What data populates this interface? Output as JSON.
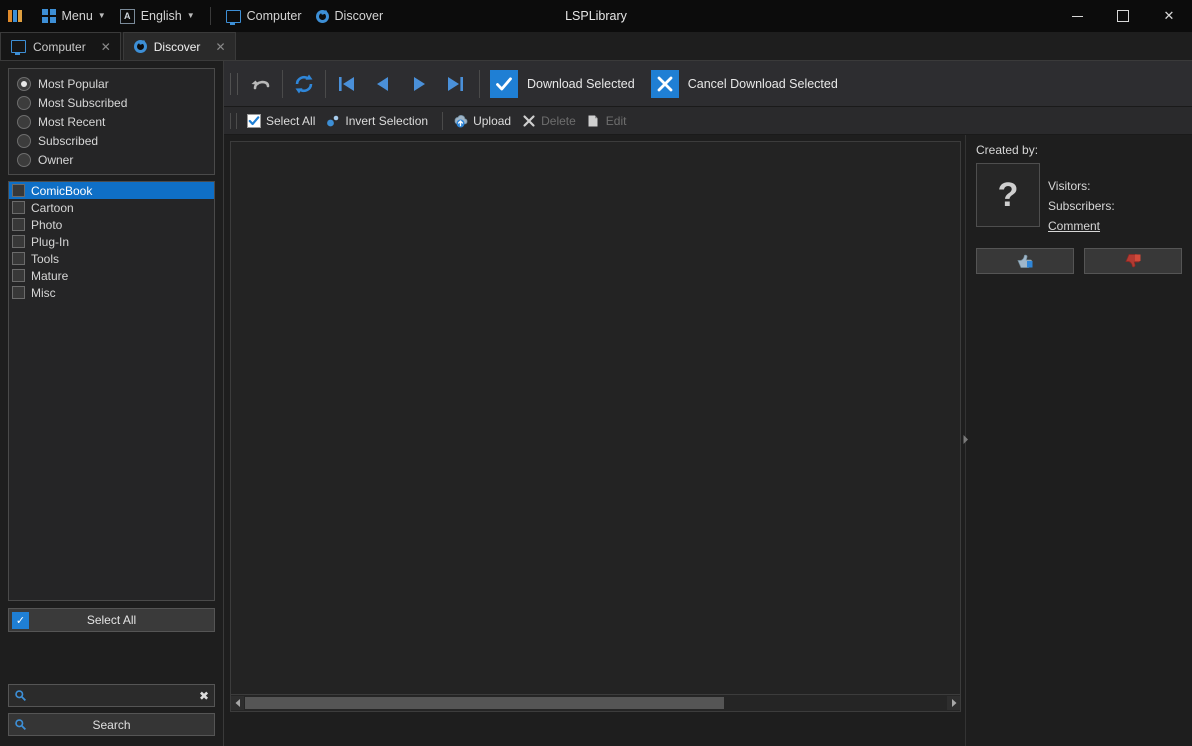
{
  "window": {
    "title": "LSPLibrary",
    "minimize_label": "─",
    "maximize_label": "□",
    "close_label": "✕"
  },
  "menubar": {
    "logo": "lsp-logo-icon",
    "items": [
      {
        "label": "Menu",
        "icon": "windows-grid-icon",
        "has_caret": true
      },
      {
        "label": "English",
        "icon": "language-a-icon",
        "has_caret": true
      }
    ],
    "links": [
      {
        "label": "Computer",
        "icon": "monitor-icon"
      },
      {
        "label": "Discover",
        "icon": "discover-globe-icon"
      }
    ]
  },
  "tabs": [
    {
      "label": "Computer",
      "icon": "monitor-icon",
      "close": "✕",
      "active": false
    },
    {
      "label": "Discover",
      "icon": "discover-globe-icon",
      "close": "✕",
      "active": true
    }
  ],
  "sidebar": {
    "sort_options": [
      {
        "label": "Most Popular",
        "selected": true
      },
      {
        "label": "Most Subscribed",
        "selected": false
      },
      {
        "label": "Most Recent",
        "selected": false
      },
      {
        "label": "Subscribed",
        "selected": false
      },
      {
        "label": "Owner",
        "selected": false
      }
    ],
    "categories": [
      {
        "label": "ComicBook",
        "checked": false,
        "selected": true
      },
      {
        "label": "Cartoon",
        "checked": false,
        "selected": false
      },
      {
        "label": "Photo",
        "checked": false,
        "selected": false
      },
      {
        "label": "Plug-In",
        "checked": false,
        "selected": false
      },
      {
        "label": "Tools",
        "checked": false,
        "selected": false
      },
      {
        "label": "Mature",
        "checked": false,
        "selected": false
      },
      {
        "label": "Misc",
        "checked": false,
        "selected": false
      }
    ],
    "select_all_label": "Select All",
    "search": {
      "value": "",
      "placeholder": "",
      "clear_label": "✖",
      "button_label": "Search"
    }
  },
  "toolbar_primary": {
    "buttons": [
      {
        "name": "undo",
        "icon": "undo-arrow-icon"
      },
      {
        "name": "refresh",
        "icon": "refresh-icon"
      },
      {
        "name": "first",
        "icon": "skip-first-icon"
      },
      {
        "name": "previous",
        "icon": "previous-icon"
      },
      {
        "name": "next",
        "icon": "next-icon"
      },
      {
        "name": "last",
        "icon": "skip-last-icon"
      }
    ],
    "download_selected_label": "Download Selected",
    "cancel_download_label": "Cancel Download Selected"
  },
  "toolbar_secondary": {
    "select_all_label": "Select All",
    "invert_selection_label": "Invert Selection",
    "upload_label": "Upload",
    "delete_label": "Delete",
    "edit_label": "Edit",
    "delete_disabled": true,
    "edit_disabled": true
  },
  "details": {
    "created_by_label": "Created by:",
    "avatar_placeholder": "?",
    "visitors_label": "Visitors:",
    "subscribers_label": "Subscribers:",
    "comment_label": "Comment",
    "thumbs_up": "thumbs-up-icon",
    "thumbs_down": "thumbs-down-icon"
  },
  "colors": {
    "accent_blue": "#1f7fd4",
    "selection_blue": "#0f6fc6",
    "icon_blue": "#3d8fd6",
    "thumb_down_red": "#c0392b",
    "window_bg": "#1e1e1e",
    "titlebar_bg": "#0c0c0c",
    "toolbar_bg": "#2d2d30"
  }
}
